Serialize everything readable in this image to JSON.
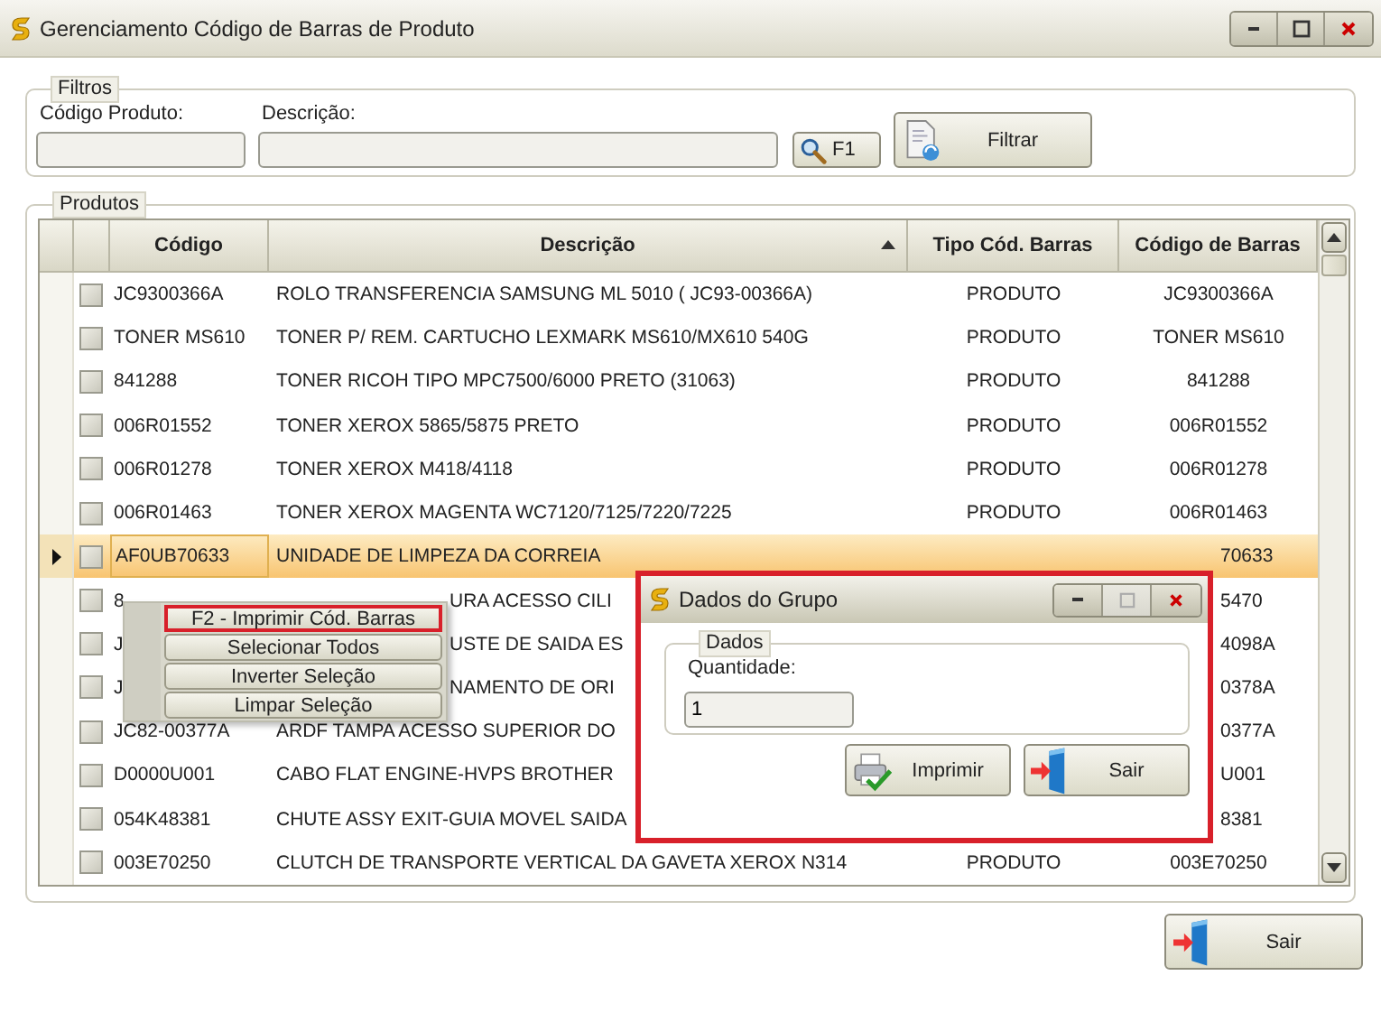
{
  "window": {
    "title": "Gerenciamento Código de Barras de Produto",
    "controls": [
      {
        "kind": "minimize",
        "disabled": false
      },
      {
        "kind": "maximize",
        "disabled": false
      },
      {
        "kind": "close",
        "disabled": false
      }
    ]
  },
  "filters": {
    "legend": "Filtros",
    "code_label": "Código Produto:",
    "description_label": "Descrição:",
    "search_button": "F1",
    "filter_button": "Filtrar"
  },
  "products": {
    "legend": "Produtos",
    "columns": [
      {
        "label": "Código",
        "sorted": false
      },
      {
        "label": "Descrição",
        "sorted": true
      },
      {
        "label": "Tipo Cód. Barras",
        "sorted": false
      },
      {
        "label": "Código de Barras",
        "sorted": false
      }
    ],
    "rows": [
      {
        "code": "JC9300366A",
        "description": "ROLO TRANSFERENCIA SAMSUNG ML 5010 ( JC93-00366A)",
        "type": "PRODUTO",
        "barcode": "JC9300366A",
        "checked": false,
        "selected": false,
        "under_menu": false
      },
      {
        "code": "TONER MS610",
        "description": "TONER P/ REM. CARTUCHO  LEXMARK  MS610/MX610  540G",
        "type": "PRODUTO",
        "barcode": "TONER MS610",
        "checked": false,
        "selected": false,
        "under_menu": false
      },
      {
        "code": "841288",
        "description": "TONER RICOH TIPO MPC7500/6000 PRETO (31063)",
        "type": "PRODUTO",
        "barcode": "841288",
        "checked": false,
        "selected": false,
        "under_menu": false
      },
      {
        "code": "006R01552",
        "description": "TONER XEROX 5865/5875 PRETO",
        "type": "PRODUTO",
        "barcode": "006R01552",
        "checked": false,
        "selected": false,
        "under_menu": false
      },
      {
        "code": "006R01278",
        "description": "TONER XEROX M418/4118",
        "type": "PRODUTO",
        "barcode": "006R01278",
        "checked": false,
        "selected": false,
        "under_menu": false
      },
      {
        "code": "006R01463",
        "description": "TONER XEROX MAGENTA WC7120/7125/7220/7225",
        "type": "PRODUTO",
        "barcode": "006R01463",
        "checked": false,
        "selected": false,
        "under_menu": false
      },
      {
        "code": "AF0UB70633",
        "description": "UNIDADE DE LIMPEZA DA CORREIA",
        "barcode": "70633",
        "checked": false,
        "selected": true,
        "under_menu": false
      },
      {
        "code": "8",
        "description": "URA ACESSO CILI",
        "barcode": "5470",
        "checked": false,
        "selected": false,
        "under_menu": true
      },
      {
        "code": "J",
        "description": "USTE DE SAIDA ES",
        "barcode": "4098A",
        "checked": false,
        "selected": false,
        "under_menu": true
      },
      {
        "code": "J",
        "description": "NAMENTO DE ORI",
        "barcode": "0378A",
        "checked": false,
        "selected": false,
        "under_menu": true
      },
      {
        "code": "JC82-00377A",
        "description": "ARDF TAMPA ACESSO SUPERIOR DO",
        "barcode": "0377A",
        "checked": false,
        "selected": false,
        "under_menu": false
      },
      {
        "code": "D0000U001",
        "description": "CABO FLAT ENGINE-HVPS BROTHER",
        "barcode": "U001",
        "checked": false,
        "selected": false,
        "under_menu": false
      },
      {
        "code": "054K48381",
        "description": "CHUTE ASSY EXIT-GUIA MOVEL SAIDA",
        "barcode": "8381",
        "checked": false,
        "selected": false,
        "under_menu": false
      },
      {
        "code": "003E70250",
        "description": "CLUTCH DE TRANSPORTE VERTICAL DA GAVETA XEROX N314",
        "type": "PRODUTO",
        "barcode": "003E70250",
        "checked": false,
        "selected": false,
        "under_menu": false
      }
    ]
  },
  "context_menu": {
    "items": [
      {
        "label": "F2 - Imprimir Cód. Barras",
        "highlighted": true
      },
      {
        "label": "Selecionar Todos",
        "highlighted": false
      },
      {
        "label": "Inverter Seleção",
        "highlighted": false
      },
      {
        "label": "Limpar Seleção",
        "highlighted": false
      }
    ]
  },
  "dialog": {
    "title": "Dados do Grupo",
    "highlighted": true,
    "controls": [
      {
        "kind": "minimize",
        "disabled": false
      },
      {
        "kind": "maximize",
        "disabled": true
      },
      {
        "kind": "close",
        "disabled": false
      }
    ],
    "legend": "Dados",
    "quantity_label": "Quantidade:",
    "quantity_value": "1",
    "print_button": "Imprimir",
    "exit_button": "Sair"
  },
  "exit_button": "Sair"
}
